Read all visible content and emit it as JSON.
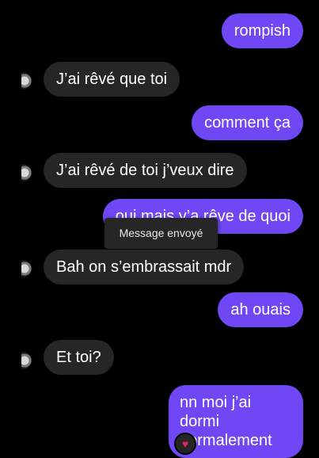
{
  "messages": [
    {
      "id": "m1",
      "side": "sent",
      "text": "rompish"
    },
    {
      "id": "m2",
      "side": "received",
      "text": "J’ai rêvé que toi"
    },
    {
      "id": "m3",
      "side": "sent",
      "text": "comment ça"
    },
    {
      "id": "m4",
      "side": "received",
      "text": "J’ai rêvé de toi j’veux dire"
    },
    {
      "id": "m5",
      "side": "sent",
      "text": "oui mais y’a rêve de quoi"
    },
    {
      "id": "m6",
      "side": "received",
      "text": "Bah on s’embrassait mdr"
    },
    {
      "id": "m7",
      "side": "sent",
      "text": "ah ouais"
    },
    {
      "id": "m8",
      "side": "received",
      "text": "Et toi?"
    },
    {
      "id": "m9",
      "side": "sent",
      "line1": "nn moi j’ai dormi",
      "line2": "normalement"
    }
  ],
  "tooltip": {
    "text": "Message envoyé"
  },
  "reaction": {
    "emoji": "♥",
    "icon": "heart-icon",
    "color": "#e0245e"
  },
  "colors": {
    "background": "#000000",
    "sent_bubble": "#6f47f4",
    "received_bubble": "#262626",
    "text": "#ffffff"
  }
}
